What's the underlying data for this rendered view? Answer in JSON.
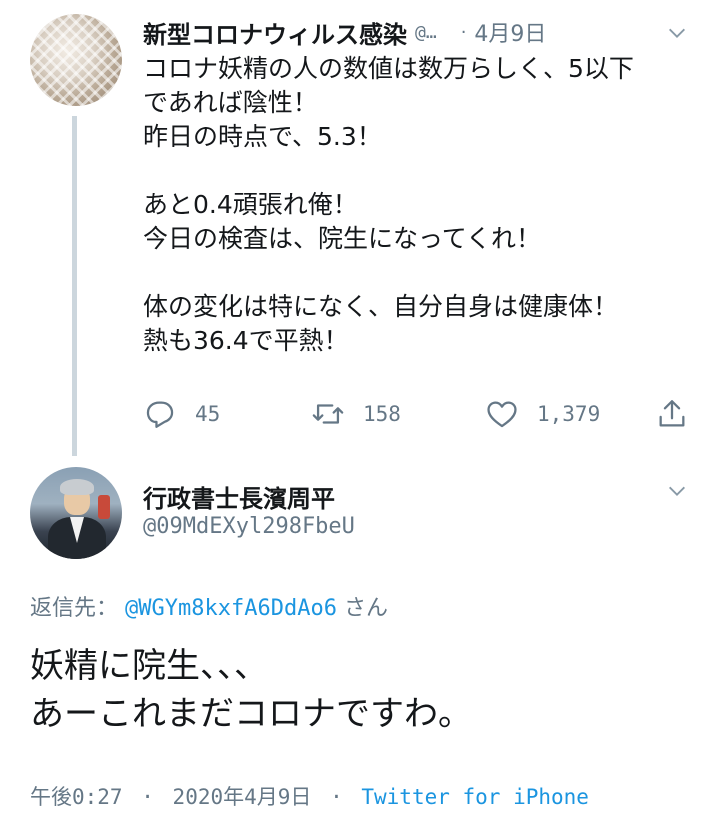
{
  "tweet1": {
    "display_name": "新型コロナウィルス感染",
    "handle": "@…",
    "dot": "·",
    "date": "4月9日",
    "lines": [
      "コロナ妖精の人の数値は数万らしく、5以下",
      "であれば陰性！",
      "昨日の時点で、5.3！",
      "",
      "あと0.4頑張れ俺！",
      "今日の検査は、院生になってくれ！",
      "",
      "体の変化は特になく、自分自身は健康体！",
      "熱も36.4で平熱！"
    ],
    "actions": {
      "reply_count": "45",
      "retweet_count": "158",
      "like_count": "1,379"
    },
    "icons": {
      "avatar": "avatar",
      "menu": "chevron-down-icon",
      "reply": "reply-icon",
      "retweet": "retweet-icon",
      "like": "heart-icon",
      "share": "share-icon"
    }
  },
  "tweet2": {
    "display_name": "行政書士長濱周平",
    "handle": "@09MdEXyl298FbeU",
    "reply_to_label": "返信先：",
    "reply_to_mention": "@WGYm8kxfA6DdAo6",
    "reply_to_suffix": "さん",
    "lines": [
      "妖精に院生、、、",
      "あーこれまだコロナですわ。"
    ],
    "time": "午後0:27",
    "sep": "·",
    "date": "2020年4月9日",
    "source": "Twitter for iPhone"
  },
  "colors": {
    "text": "#14171a",
    "secondary": "#657786",
    "link": "#1b95e0",
    "thread_line": "#ccd6dd"
  }
}
